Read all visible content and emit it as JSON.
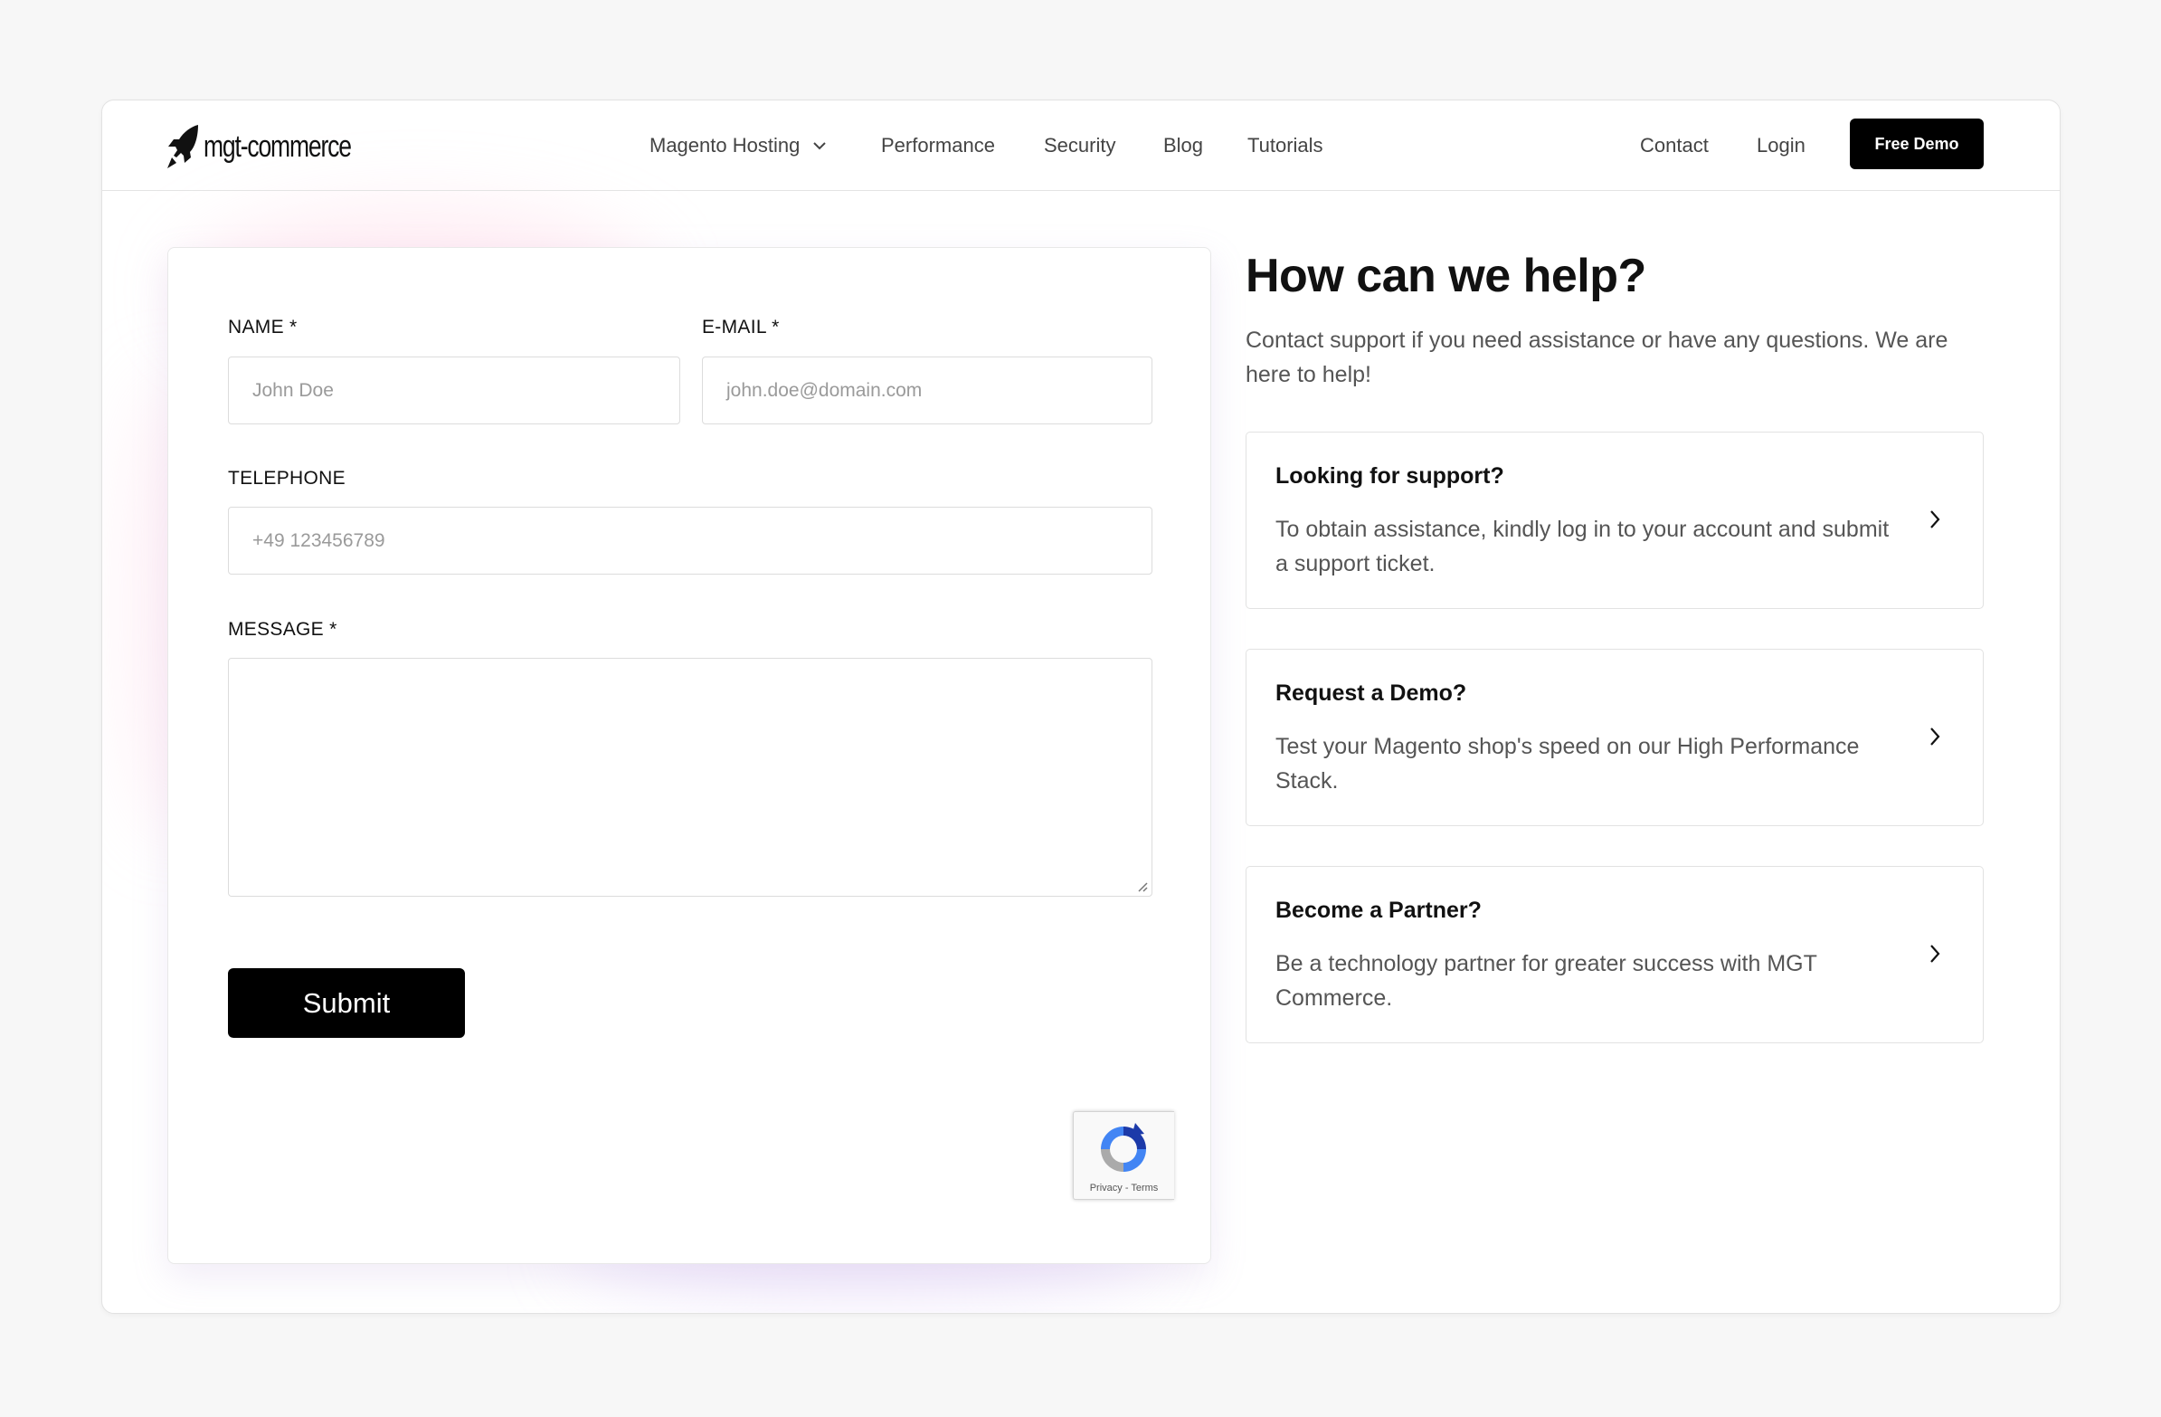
{
  "header": {
    "logo_text": "mgt-commerce",
    "nav": [
      {
        "label": "Magento Hosting",
        "has_dropdown": true
      },
      {
        "label": "Performance"
      },
      {
        "label": "Security"
      },
      {
        "label": "Blog"
      },
      {
        "label": "Tutorials"
      }
    ],
    "contact_label": "Contact",
    "login_label": "Login",
    "free_demo_label": "Free Demo"
  },
  "form": {
    "name_label": "NAME *",
    "name_placeholder": "John Doe",
    "email_label": "E-MAIL *",
    "email_placeholder": "john.doe@domain.com",
    "telephone_label": "TELEPHONE",
    "telephone_placeholder": "+49 123456789",
    "message_label": "MESSAGE *",
    "message_value": "",
    "submit_label": "Submit",
    "recaptcha_links": "Privacy - Terms"
  },
  "help": {
    "title": "How can we help?",
    "subtitle": "Contact support if you need assistance or have any questions. We are here to help!",
    "cards": [
      {
        "title": "Looking for support?",
        "text": "To obtain assistance, kindly log in to your account and submit a support ticket."
      },
      {
        "title": "Request a Demo?",
        "text": "Test your Magento shop's speed on our High Performance Stack."
      },
      {
        "title": "Become a Partner?",
        "text": "Be a technology partner for greater success with MGT Commerce."
      }
    ]
  },
  "colors": {
    "page_bg": "#f7f7f7",
    "primary_button": "#000000",
    "border": "#e2e2e2",
    "muted_text": "#555555"
  }
}
